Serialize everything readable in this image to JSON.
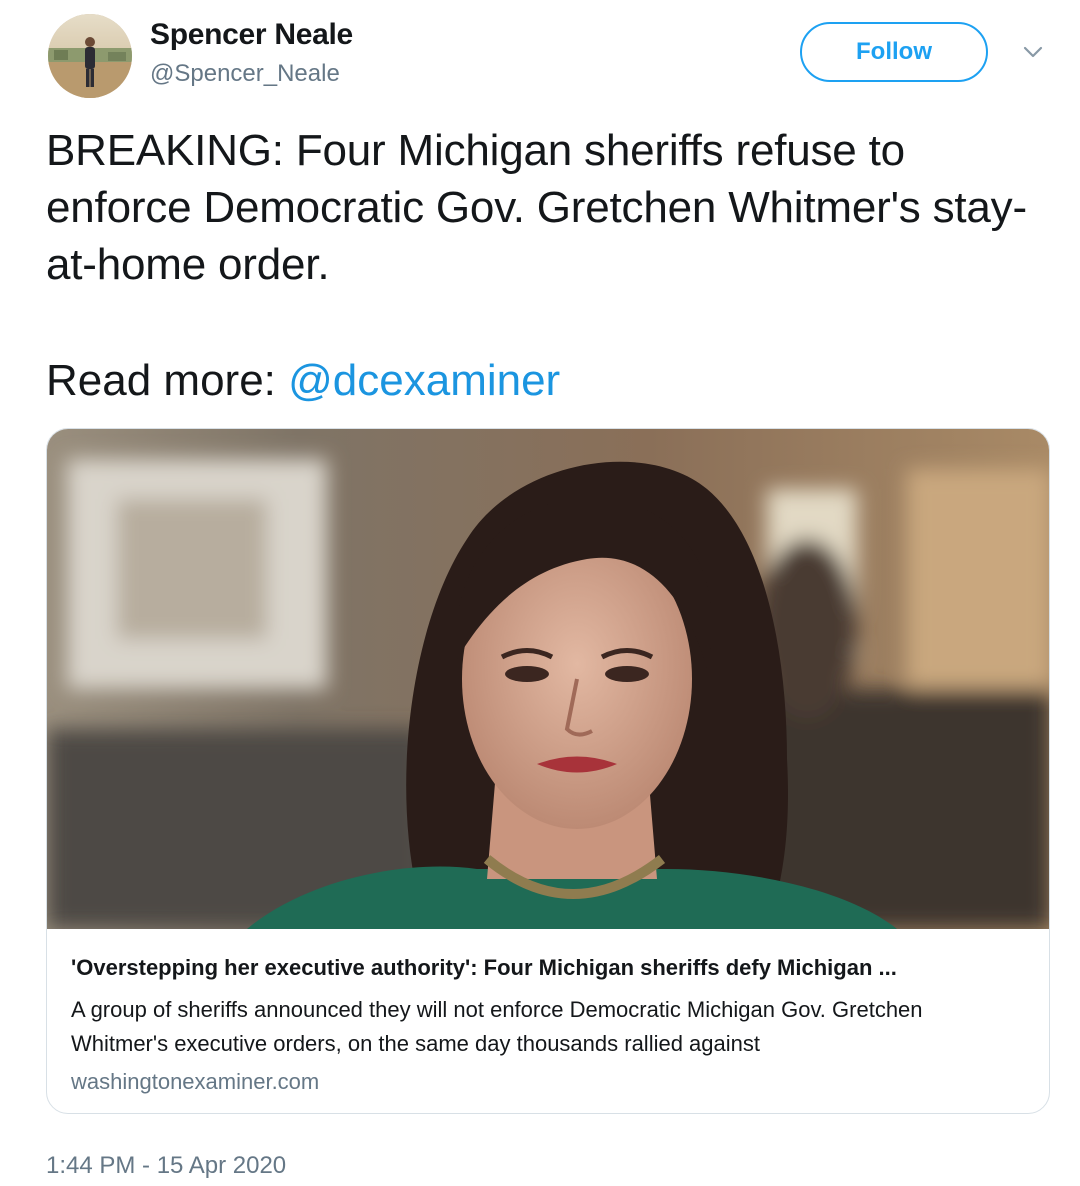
{
  "author": {
    "display_name": "Spencer Neale",
    "handle": "@Spencer_Neale",
    "avatar_icon": "profile-photo"
  },
  "actions": {
    "follow_label": "Follow",
    "menu_icon": "chevron-down-icon"
  },
  "tweet": {
    "text": "BREAKING: Four Michigan sheriffs refuse to enforce Democratic Gov. Gretchen Whitmer's stay-at-home order.",
    "read_more_prefix": "Read more: ",
    "mention": "@dcexaminer"
  },
  "card": {
    "title": "'Overstepping her executive authority': Four Michigan sheriffs defy Michigan ...",
    "description": "A group of sheriffs announced they will not enforce Democratic Michigan Gov. Gretchen Whitmer's executive orders, on the same day thousands rallied against",
    "domain": "washingtonexaminer.com"
  },
  "timestamp": "1:44 PM - 15 Apr 2020",
  "colors": {
    "accent": "#1da1f2",
    "link": "#1b95e0",
    "text": "#14171a",
    "muted": "#657786",
    "border": "#d8e0e6"
  }
}
